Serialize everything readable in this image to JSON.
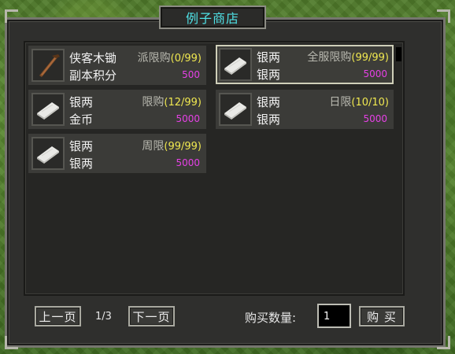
{
  "window": {
    "title": "例子商店"
  },
  "items": [
    {
      "name": "侠客木锄",
      "limit_label": "派限购",
      "limit_count": "(0/99)",
      "cost_currency": "副本积分",
      "price": "500",
      "icon": "wooden-hoe-icon",
      "selected": false
    },
    {
      "name": "银两",
      "limit_label": "全服限购",
      "limit_count": "(99/99)",
      "cost_currency": "银两",
      "price": "5000",
      "icon": "paper-scroll-icon",
      "selected": true
    },
    {
      "name": "银两",
      "limit_label": "限购",
      "limit_count": "(12/99)",
      "cost_currency": "金币",
      "price": "5000",
      "icon": "paper-scroll-icon",
      "selected": false
    },
    {
      "name": "银两",
      "limit_label": "日限",
      "limit_count": "(10/10)",
      "cost_currency": "银两",
      "price": "5000",
      "icon": "paper-scroll-icon",
      "selected": false
    },
    {
      "name": "银两",
      "limit_label": "周限",
      "limit_count": "(99/99)",
      "cost_currency": "银两",
      "price": "5000",
      "icon": "paper-scroll-icon",
      "selected": false
    }
  ],
  "pagination": {
    "prev_label": "上一页",
    "next_label": "下一页",
    "page": "1/3"
  },
  "purchase": {
    "qty_label": "购买数量:",
    "qty_value": "1",
    "buy_label": "购 买"
  },
  "colors": {
    "title": "#4fe2e6",
    "limit_count": "#f0e850",
    "price": "#e640e6",
    "panel": "#2f2f2d"
  }
}
